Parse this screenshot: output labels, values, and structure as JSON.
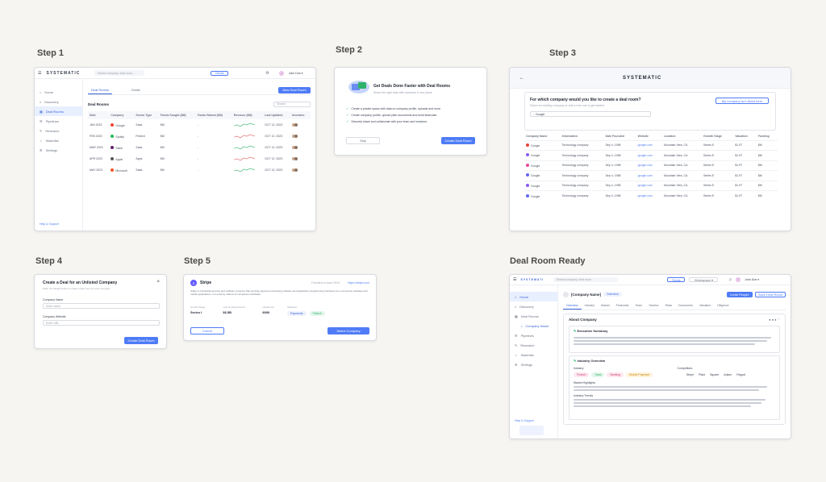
{
  "steps": {
    "s1": "Step 1",
    "s2": "Step 2",
    "s3": "Step 3",
    "s4": "Step 4",
    "s5": "Step 5",
    "ready": "Deal Room Ready"
  },
  "colors": {
    "accent": "#4f7cf6",
    "green": "#2fb36b",
    "red": "#e25c5c"
  },
  "step1": {
    "logo": "SYSTEMATIC",
    "search_placeholder": "Search company, deal room...",
    "sidebar": [
      "Home",
      "Discovery",
      "Deal Rooms",
      "Pipelines",
      "Research",
      "Watchlist",
      "Settings"
    ],
    "tabs": [
      "Deal Rooms",
      "Drafts"
    ],
    "new_button": "New Deal Room",
    "section_title": "Deal Rooms",
    "search_deals": "Search",
    "columns": [
      "Date",
      "Company",
      "Sector Type",
      "Funds Sought ($M)",
      "Funds Raised ($M)",
      "Revenue ($M)",
      "Last Updated",
      "Investors"
    ],
    "rows": [
      {
        "date": "JAN 2023",
        "company": "Google",
        "sector": "Saas",
        "sought": "$M",
        "raised": "-",
        "updated": "OCT 12, 2023",
        "logo_color": "#ea4335"
      },
      {
        "date": "FEB 2023",
        "company": "Spotify",
        "sector": "Fintech",
        "sought": "$M",
        "raised": "-",
        "updated": "OCT 12, 2023",
        "logo_color": "#1db954"
      },
      {
        "date": "MAR 2023",
        "company": "Slack",
        "sector": "Saas",
        "sought": "$M",
        "raised": "-",
        "updated": "OCT 12, 2023",
        "logo_color": "#611f69"
      },
      {
        "date": "APR 2023",
        "company": "Apple",
        "sector": "Apps",
        "sought": "$M",
        "raised": "-",
        "updated": "OCT 12, 2023",
        "logo_color": "#555555"
      },
      {
        "date": "MAY 2023",
        "company": "Microsoft",
        "sector": "Saas",
        "sought": "$M",
        "raised": "-",
        "updated": "OCT 12, 2023",
        "logo_color": "#f25022"
      }
    ],
    "help": "Help & Support"
  },
  "step2": {
    "title": "Get Deals Done Faster with Deal Rooms",
    "subtitle": "Share the right data with investors in one place",
    "bullets": [
      "Create a private space with data on company profile, uploads and more",
      "Create company profile, upload pitch documents and build financials",
      "Securely share and collaborate with your team and investors"
    ],
    "skip": "Skip",
    "cta": "Create Deal Room"
  },
  "step3": {
    "back": "←",
    "logo": "SYSTEMATIC",
    "question": "For which company would you like to create a deal room?",
    "hint": "Select an existing company or add a new one to get started",
    "search_value": "Google",
    "add_button": "My company isn't listed here",
    "columns": [
      "Company Name",
      "Information",
      "Date Founded",
      "Website",
      "Location",
      "Growth Stage",
      "Valuation",
      "Funding"
    ],
    "rows": [
      {
        "name": "Google",
        "info": "Technology company",
        "date": "Sep 4, 1998",
        "site": "google.com",
        "loc": "Mountain View, CA",
        "stage": "Series E",
        "val": "$1.9T",
        "fund": "$M",
        "color": "#ea4335"
      },
      {
        "name": "Google",
        "info": "Technology company",
        "date": "Sep 4, 1998",
        "site": "google.com",
        "loc": "Mountain View, CA",
        "stage": "Series E",
        "val": "$1.9T",
        "fund": "$M",
        "color": "#8b5cf6"
      },
      {
        "name": "Google",
        "info": "Technology company",
        "date": "Sep 4, 1998",
        "site": "google.com",
        "loc": "Mountain View, CA",
        "stage": "Series E",
        "val": "$1.9T",
        "fund": "$M",
        "color": "#ec4899"
      },
      {
        "name": "Google",
        "info": "Technology company",
        "date": "Sep 4, 1998",
        "site": "google.com",
        "loc": "Mountain View, CA",
        "stage": "Series E",
        "val": "$1.9T",
        "fund": "$M",
        "color": "#6366f1"
      },
      {
        "name": "Google",
        "info": "Technology company",
        "date": "Sep 4, 1998",
        "site": "google.com",
        "loc": "Mountain View, CA",
        "stage": "Series E",
        "val": "$1.9T",
        "fund": "$M",
        "color": "#8b5cf6"
      },
      {
        "name": "Google",
        "info": "Technology company",
        "date": "Sep 4, 1998",
        "site": "google.com",
        "loc": "Mountain View, CA",
        "stage": "Series E",
        "val": "$1.9T",
        "fund": "$M",
        "color": "#6366f1"
      }
    ]
  },
  "step4": {
    "title": "Create a Deal for an Unlisted Company",
    "subtitle": "Enter the details below to create a deal room for your company",
    "close": "×",
    "field1_label": "Company Name",
    "field1_placeholder": "Enter name",
    "field2_label": "Company Website",
    "field2_placeholder": "Enter URL",
    "cta": "Create Deal Room"
  },
  "step5": {
    "company": "Stripe",
    "founded": "Founded in June 2010",
    "site": "https://stripe.com",
    "description": "Stripe is a financial services and software company that provides payment processing software and application programming interfaces for e-commerce websites and mobile applications. It is used by millions of companies worldwide.",
    "stats": [
      {
        "label": "Growth Stage",
        "value": "Series I"
      },
      {
        "label": "Last Funding Round",
        "value": "$6.5B"
      },
      {
        "label": "Headcount",
        "value": "8000"
      },
      {
        "label": "Valuation",
        "value": "$50B"
      }
    ],
    "tags": [
      "Payments",
      "Fintech"
    ],
    "cancel": "Cancel",
    "cta": "Select Company"
  },
  "ready": {
    "logo": "SYSTEMATIC",
    "search_placeholder": "Search company, deal room...",
    "sidebar": [
      "Home",
      "Discovery",
      "Deal Rooms",
      "Pipelines",
      "Research",
      "Watchlist",
      "Settings"
    ],
    "sub_item": "Company Name",
    "room_title": "[Company Name]",
    "badge": "Overview",
    "share_btn": "Invite People",
    "save_btn": "Save Deal Room",
    "tabs": [
      "Overview",
      "Industry",
      "Market",
      "Financials",
      "Team",
      "Traction",
      "Risks",
      "Documents",
      "Valuation",
      "Diligence"
    ],
    "panel_title": "About Company",
    "exec_title": "Executive Summary",
    "industry_title": "Industry Overview",
    "industry_label": "Industry",
    "industry_tags": [
      "Fintech",
      "Saas",
      "Banking",
      "Mobile Payment"
    ],
    "competitors_label": "Competitors",
    "competitors": [
      "Stripe",
      "Plaid",
      "Square",
      "Adyen",
      "Paypal"
    ],
    "market_label": "Market Highlights",
    "trends_label": "Industry Trends",
    "help": "Help & Support"
  }
}
